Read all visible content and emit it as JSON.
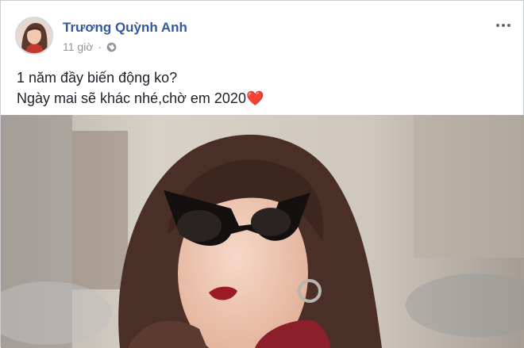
{
  "post": {
    "author_name": "Trương Quỳnh Anh",
    "timestamp": "11 giờ",
    "privacy_icon": "globe-icon",
    "text_line1": "1 năm đầy biến động ko?",
    "text_line2": "Ngày mai sẽ khác nhé,chờ em 2020",
    "text_emoji": "❤️",
    "options_icon": "more-options-icon"
  },
  "colors": {
    "author_link": "#365899",
    "meta_gray": "#90949c",
    "heart": "#e0245e"
  }
}
